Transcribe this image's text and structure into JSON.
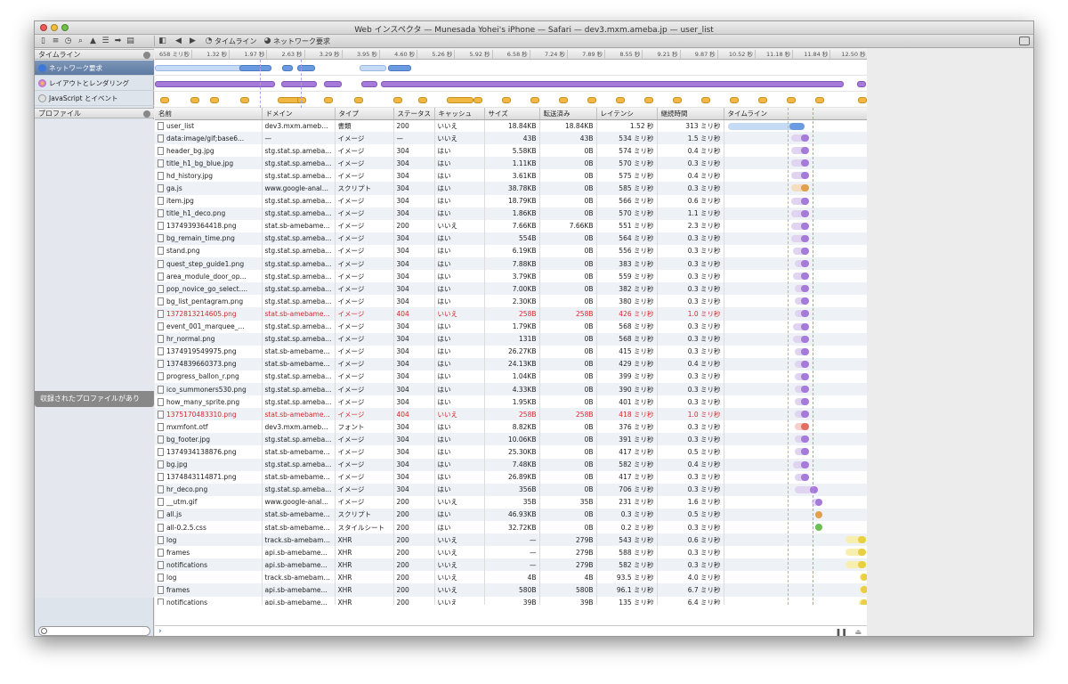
{
  "window": {
    "title": "Web インスペクタ — Munesada Yohei's iPhone — Safari — dev3.mxm.ameba.jp — user_list"
  },
  "toolbar": {
    "crumbs": [
      "タイムライン",
      "ネットワーク要求"
    ]
  },
  "sidebar": {
    "timeline_header": "タイムライン",
    "items": [
      {
        "label": "ネットワーク要求",
        "selected": true,
        "icon": "network-icon",
        "color": "#3d78d8"
      },
      {
        "label": "レイアウトとレンダリング",
        "selected": false,
        "icon": "layout-icon",
        "color": "#c86bd8"
      },
      {
        "label": "JavaScript とイベント",
        "selected": false,
        "icon": "script-icon",
        "color": "#b0b0b0"
      }
    ],
    "profile_header": "プロファイル",
    "profile_empty": "収録されたプロファイルがあり"
  },
  "ruler": {
    "ticks": [
      "658 ミリ秒",
      "1.32 秒",
      "1.97 秒",
      "2.63 秒",
      "3.29 秒",
      "3.95 秒",
      "4.60 秒",
      "5.26 秒",
      "5.92 秒",
      "6.58 秒",
      "7.24 秒",
      "7.89 秒",
      "8.55 秒",
      "9.21 秒",
      "9.87 秒",
      "10.52 秒",
      "11.18 秒",
      "11.84 秒",
      "12.50 秒"
    ]
  },
  "columns": [
    "名前",
    "ドメイン",
    "タイプ",
    "ステータス",
    "キャッシュ",
    "サイズ",
    "転送済み",
    "レイテンシ",
    "継続時間",
    "タイムライン"
  ],
  "rows": [
    {
      "name": "user_list",
      "domain": "dev3.mxm.ameba...",
      "type": "書類",
      "status": "200",
      "cache": "いいえ",
      "size": "18.84KB",
      "transfer": "18.84KB",
      "latency": "1.52 秒",
      "duration": "313 ミリ秒",
      "kind": "doc",
      "wf": [
        0,
        0.6,
        0.75
      ]
    },
    {
      "name": "data:image/gif;base6...",
      "domain": "—",
      "type": "イメージ",
      "status": "—",
      "cache": "いいえ",
      "size": "43B",
      "transfer": "43B",
      "latency": "534 ミリ秒",
      "duration": "1.5 ミリ秒",
      "kind": "img",
      "wf": [
        0.62,
        0.72,
        0.8
      ]
    },
    {
      "name": "header_bg.jpg",
      "domain": "stg.stat.sp.ameba...",
      "type": "イメージ",
      "status": "304",
      "cache": "はい",
      "size": "5.58KB",
      "transfer": "0B",
      "latency": "574 ミリ秒",
      "duration": "0.4 ミリ秒",
      "kind": "img",
      "wf": [
        0.62,
        0.72,
        0.8
      ]
    },
    {
      "name": "title_h1_bg_blue.jpg",
      "domain": "stg.stat.sp.ameba...",
      "type": "イメージ",
      "status": "304",
      "cache": "はい",
      "size": "1.11KB",
      "transfer": "0B",
      "latency": "570 ミリ秒",
      "duration": "0.3 ミリ秒",
      "kind": "img",
      "wf": [
        0.62,
        0.72,
        0.8
      ]
    },
    {
      "name": "hd_history.jpg",
      "domain": "stg.stat.sp.ameba...",
      "type": "イメージ",
      "status": "304",
      "cache": "はい",
      "size": "3.61KB",
      "transfer": "0B",
      "latency": "575 ミリ秒",
      "duration": "0.4 ミリ秒",
      "kind": "img",
      "wf": [
        0.62,
        0.72,
        0.8
      ]
    },
    {
      "name": "ga.js",
      "domain": "www.google-anal...",
      "type": "スクリプト",
      "status": "304",
      "cache": "はい",
      "size": "38.78KB",
      "transfer": "0B",
      "latency": "585 ミリ秒",
      "duration": "0.3 ミリ秒",
      "kind": "script",
      "wf": [
        0.62,
        0.72,
        0.8
      ]
    },
    {
      "name": "item.jpg",
      "domain": "stg.stat.sp.ameba...",
      "type": "イメージ",
      "status": "304",
      "cache": "はい",
      "size": "18.79KB",
      "transfer": "0B",
      "latency": "566 ミリ秒",
      "duration": "0.6 ミリ秒",
      "kind": "img",
      "wf": [
        0.62,
        0.72,
        0.8
      ]
    },
    {
      "name": "title_h1_deco.png",
      "domain": "stg.stat.sp.ameba...",
      "type": "イメージ",
      "status": "304",
      "cache": "はい",
      "size": "1.86KB",
      "transfer": "0B",
      "latency": "570 ミリ秒",
      "duration": "1.1 ミリ秒",
      "kind": "img",
      "wf": [
        0.62,
        0.72,
        0.8
      ]
    },
    {
      "name": "1374939364418.png",
      "domain": "stat.sb-amebame...",
      "type": "イメージ",
      "status": "200",
      "cache": "いいえ",
      "size": "7.66KB",
      "transfer": "7.66KB",
      "latency": "551 ミリ秒",
      "duration": "2.3 ミリ秒",
      "kind": "img",
      "wf": [
        0.62,
        0.72,
        0.8
      ]
    },
    {
      "name": "bg_remain_time.png",
      "domain": "stg.stat.sp.ameba...",
      "type": "イメージ",
      "status": "304",
      "cache": "はい",
      "size": "554B",
      "transfer": "0B",
      "latency": "564 ミリ秒",
      "duration": "0.3 ミリ秒",
      "kind": "img",
      "wf": [
        0.62,
        0.72,
        0.8
      ]
    },
    {
      "name": "stand.png",
      "domain": "stg.stat.sp.ameba...",
      "type": "イメージ",
      "status": "304",
      "cache": "はい",
      "size": "6.19KB",
      "transfer": "0B",
      "latency": "556 ミリ秒",
      "duration": "0.3 ミリ秒",
      "kind": "img",
      "wf": [
        0.64,
        0.72,
        0.8
      ]
    },
    {
      "name": "quest_step_guide1.png",
      "domain": "stg.stat.sp.ameba...",
      "type": "イメージ",
      "status": "304",
      "cache": "はい",
      "size": "7.88KB",
      "transfer": "0B",
      "latency": "383 ミリ秒",
      "duration": "0.3 ミリ秒",
      "kind": "img",
      "wf": [
        0.66,
        0.72,
        0.8
      ]
    },
    {
      "name": "area_module_door_op...",
      "domain": "stg.stat.sp.ameba...",
      "type": "イメージ",
      "status": "304",
      "cache": "はい",
      "size": "3.79KB",
      "transfer": "0B",
      "latency": "559 ミリ秒",
      "duration": "0.3 ミリ秒",
      "kind": "img",
      "wf": [
        0.64,
        0.72,
        0.8
      ]
    },
    {
      "name": "pop_novice_go_select....",
      "domain": "stg.stat.sp.ameba...",
      "type": "イメージ",
      "status": "304",
      "cache": "はい",
      "size": "7.00KB",
      "transfer": "0B",
      "latency": "382 ミリ秒",
      "duration": "0.3 ミリ秒",
      "kind": "img",
      "wf": [
        0.66,
        0.72,
        0.8
      ]
    },
    {
      "name": "bg_list_pentagram.png",
      "domain": "stg.stat.sp.ameba...",
      "type": "イメージ",
      "status": "304",
      "cache": "はい",
      "size": "2.30KB",
      "transfer": "0B",
      "latency": "380 ミリ秒",
      "duration": "0.3 ミリ秒",
      "kind": "img",
      "wf": [
        0.66,
        0.72,
        0.8
      ]
    },
    {
      "name": "1372813214605.png",
      "domain": "stat.sb-amebame...",
      "type": "イメージ",
      "status": "404",
      "cache": "いいえ",
      "size": "258B",
      "transfer": "258B",
      "latency": "426 ミリ秒",
      "duration": "1.0 ミリ秒",
      "kind": "img",
      "err": true,
      "wf": [
        0.66,
        0.72,
        0.8
      ]
    },
    {
      "name": "event_001_marquee_...",
      "domain": "stg.stat.sp.ameba...",
      "type": "イメージ",
      "status": "304",
      "cache": "はい",
      "size": "1.79KB",
      "transfer": "0B",
      "latency": "568 ミリ秒",
      "duration": "0.3 ミリ秒",
      "kind": "img",
      "wf": [
        0.64,
        0.72,
        0.8
      ]
    },
    {
      "name": "hr_normal.png",
      "domain": "stg.stat.sp.ameba...",
      "type": "イメージ",
      "status": "304",
      "cache": "はい",
      "size": "131B",
      "transfer": "0B",
      "latency": "568 ミリ秒",
      "duration": "0.3 ミリ秒",
      "kind": "img",
      "wf": [
        0.64,
        0.72,
        0.8
      ]
    },
    {
      "name": "1374919549975.png",
      "domain": "stat.sb-amebame...",
      "type": "イメージ",
      "status": "304",
      "cache": "はい",
      "size": "26.27KB",
      "transfer": "0B",
      "latency": "415 ミリ秒",
      "duration": "0.3 ミリ秒",
      "kind": "img",
      "wf": [
        0.66,
        0.72,
        0.8
      ]
    },
    {
      "name": "1374839660373.png",
      "domain": "stat.sb-amebame...",
      "type": "イメージ",
      "status": "304",
      "cache": "はい",
      "size": "24.13KB",
      "transfer": "0B",
      "latency": "429 ミリ秒",
      "duration": "0.4 ミリ秒",
      "kind": "img",
      "wf": [
        0.66,
        0.72,
        0.8
      ]
    },
    {
      "name": "progress_ballon_r.png",
      "domain": "stg.stat.sp.ameba...",
      "type": "イメージ",
      "status": "304",
      "cache": "はい",
      "size": "1.04KB",
      "transfer": "0B",
      "latency": "399 ミリ秒",
      "duration": "0.3 ミリ秒",
      "kind": "img",
      "wf": [
        0.66,
        0.72,
        0.8
      ]
    },
    {
      "name": "ico_summoners530.png",
      "domain": "stg.stat.sp.ameba...",
      "type": "イメージ",
      "status": "304",
      "cache": "はい",
      "size": "4.33KB",
      "transfer": "0B",
      "latency": "390 ミリ秒",
      "duration": "0.3 ミリ秒",
      "kind": "img",
      "wf": [
        0.66,
        0.72,
        0.8
      ]
    },
    {
      "name": "how_many_sprite.png",
      "domain": "stg.stat.sp.ameba...",
      "type": "イメージ",
      "status": "304",
      "cache": "はい",
      "size": "1.95KB",
      "transfer": "0B",
      "latency": "401 ミリ秒",
      "duration": "0.3 ミリ秒",
      "kind": "img",
      "wf": [
        0.66,
        0.72,
        0.8
      ]
    },
    {
      "name": "1375170483310.png",
      "domain": "stat.sb-amebame...",
      "type": "イメージ",
      "status": "404",
      "cache": "いいえ",
      "size": "258B",
      "transfer": "258B",
      "latency": "418 ミリ秒",
      "duration": "1.0 ミリ秒",
      "kind": "img",
      "err": true,
      "wf": [
        0.66,
        0.72,
        0.8
      ]
    },
    {
      "name": "mxmfont.otf",
      "domain": "dev3.mxm.ameba...",
      "type": "フォント",
      "status": "304",
      "cache": "はい",
      "size": "8.82KB",
      "transfer": "0B",
      "latency": "376 ミリ秒",
      "duration": "0.3 ミリ秒",
      "kind": "font",
      "wf": [
        0.66,
        0.72,
        0.8
      ]
    },
    {
      "name": "bg_footer.jpg",
      "domain": "stg.stat.sp.ameba...",
      "type": "イメージ",
      "status": "304",
      "cache": "はい",
      "size": "10.06KB",
      "transfer": "0B",
      "latency": "391 ミリ秒",
      "duration": "0.3 ミリ秒",
      "kind": "img",
      "wf": [
        0.66,
        0.72,
        0.8
      ]
    },
    {
      "name": "1374934138876.png",
      "domain": "stat.sb-amebame...",
      "type": "イメージ",
      "status": "304",
      "cache": "はい",
      "size": "25.30KB",
      "transfer": "0B",
      "latency": "417 ミリ秒",
      "duration": "0.5 ミリ秒",
      "kind": "img",
      "wf": [
        0.66,
        0.72,
        0.8
      ]
    },
    {
      "name": "bg.jpg",
      "domain": "stg.stat.sp.ameba...",
      "type": "イメージ",
      "status": "304",
      "cache": "はい",
      "size": "7.48KB",
      "transfer": "0B",
      "latency": "582 ミリ秒",
      "duration": "0.4 ミリ秒",
      "kind": "img",
      "wf": [
        0.64,
        0.72,
        0.8
      ]
    },
    {
      "name": "1374843114871.png",
      "domain": "stat.sb-amebame...",
      "type": "イメージ",
      "status": "304",
      "cache": "はい",
      "size": "26.89KB",
      "transfer": "0B",
      "latency": "417 ミリ秒",
      "duration": "0.3 ミリ秒",
      "kind": "img",
      "wf": [
        0.66,
        0.72,
        0.8
      ]
    },
    {
      "name": "hr_deco.png",
      "domain": "stg.stat.sp.ameba...",
      "type": "イメージ",
      "status": "304",
      "cache": "はい",
      "size": "356B",
      "transfer": "0B",
      "latency": "706 ミリ秒",
      "duration": "0.3 ミリ秒",
      "kind": "img",
      "wf": [
        0.66,
        0.8,
        0.88
      ]
    },
    {
      "name": "__utm.gif",
      "domain": "www.google-anal...",
      "type": "イメージ",
      "status": "200",
      "cache": "いいえ",
      "size": "35B",
      "transfer": "35B",
      "latency": "231 ミリ秒",
      "duration": "1.6 ミリ秒",
      "kind": "img",
      "wf": [
        0.82,
        0.86,
        0.93
      ]
    },
    {
      "name": "all.js",
      "domain": "stat.sb-amebame...",
      "type": "スクリプト",
      "status": "200",
      "cache": "はい",
      "size": "46.93KB",
      "transfer": "0B",
      "latency": "0.3 ミリ秒",
      "duration": "0.5 ミリ秒",
      "kind": "script",
      "wf": [
        0.86,
        0.86,
        0.92
      ]
    },
    {
      "name": "all-0.2.5.css",
      "domain": "stat.sb-amebame...",
      "type": "スタイルシート",
      "status": "200",
      "cache": "はい",
      "size": "32.72KB",
      "transfer": "0B",
      "latency": "0.2 ミリ秒",
      "duration": "0.3 ミリ秒",
      "kind": "css",
      "wf": [
        0.86,
        0.86,
        0.92
      ]
    },
    {
      "name": "log",
      "domain": "track.sb-amebame...",
      "type": "XHR",
      "status": "200",
      "cache": "いいえ",
      "size": "—",
      "transfer": "279B",
      "latency": "543 ミリ秒",
      "duration": "0.6 ミリ秒",
      "kind": "xhr",
      "wf": [
        1.15,
        1.27,
        1.35
      ]
    },
    {
      "name": "frames",
      "domain": "api.sb-amebame...",
      "type": "XHR",
      "status": "200",
      "cache": "いいえ",
      "size": "—",
      "transfer": "279B",
      "latency": "588 ミリ秒",
      "duration": "0.3 ミリ秒",
      "kind": "xhr",
      "wf": [
        1.15,
        1.27,
        1.35
      ]
    },
    {
      "name": "notifications",
      "domain": "api.sb-amebame...",
      "type": "XHR",
      "status": "200",
      "cache": "いいえ",
      "size": "—",
      "transfer": "279B",
      "latency": "582 ミリ秒",
      "duration": "0.3 ミリ秒",
      "kind": "xhr",
      "wf": [
        1.15,
        1.27,
        1.35
      ]
    },
    {
      "name": "log",
      "domain": "track.sb-amebame...",
      "type": "XHR",
      "status": "200",
      "cache": "いいえ",
      "size": "4B",
      "transfer": "4B",
      "latency": "93.5 ミリ秒",
      "duration": "4.0 ミリ秒",
      "kind": "xhr",
      "wf": [
        1.29,
        1.3,
        1.36
      ]
    },
    {
      "name": "frames",
      "domain": "api.sb-amebame...",
      "type": "XHR",
      "status": "200",
      "cache": "いいえ",
      "size": "580B",
      "transfer": "580B",
      "latency": "96.1 ミリ秒",
      "duration": "6.7 ミリ秒",
      "kind": "xhr",
      "wf": [
        1.29,
        1.3,
        1.36
      ]
    },
    {
      "name": "notifications",
      "domain": "api.sb-amebame...",
      "type": "XHR",
      "status": "200",
      "cache": "いいえ",
      "size": "39B",
      "transfer": "39B",
      "latency": "135 ミリ秒",
      "duration": "6.4 ミリ秒",
      "kind": "xhr",
      "wf": [
        1.28,
        1.3,
        1.36
      ]
    }
  ],
  "colors": {
    "doc": [
      "#c5daf5",
      "#6a9ae0"
    ],
    "img": [
      "#e0d4f0",
      "#a57ad8"
    ],
    "script": [
      "#f5ddc0",
      "#e0a050"
    ],
    "font": [
      "#f5cfc8",
      "#e07060"
    ],
    "css": [
      "#cfeec5",
      "#6ac050"
    ],
    "xhr": [
      "#f7efb0",
      "#e8d040"
    ]
  },
  "console": {
    "prompt": "›"
  }
}
